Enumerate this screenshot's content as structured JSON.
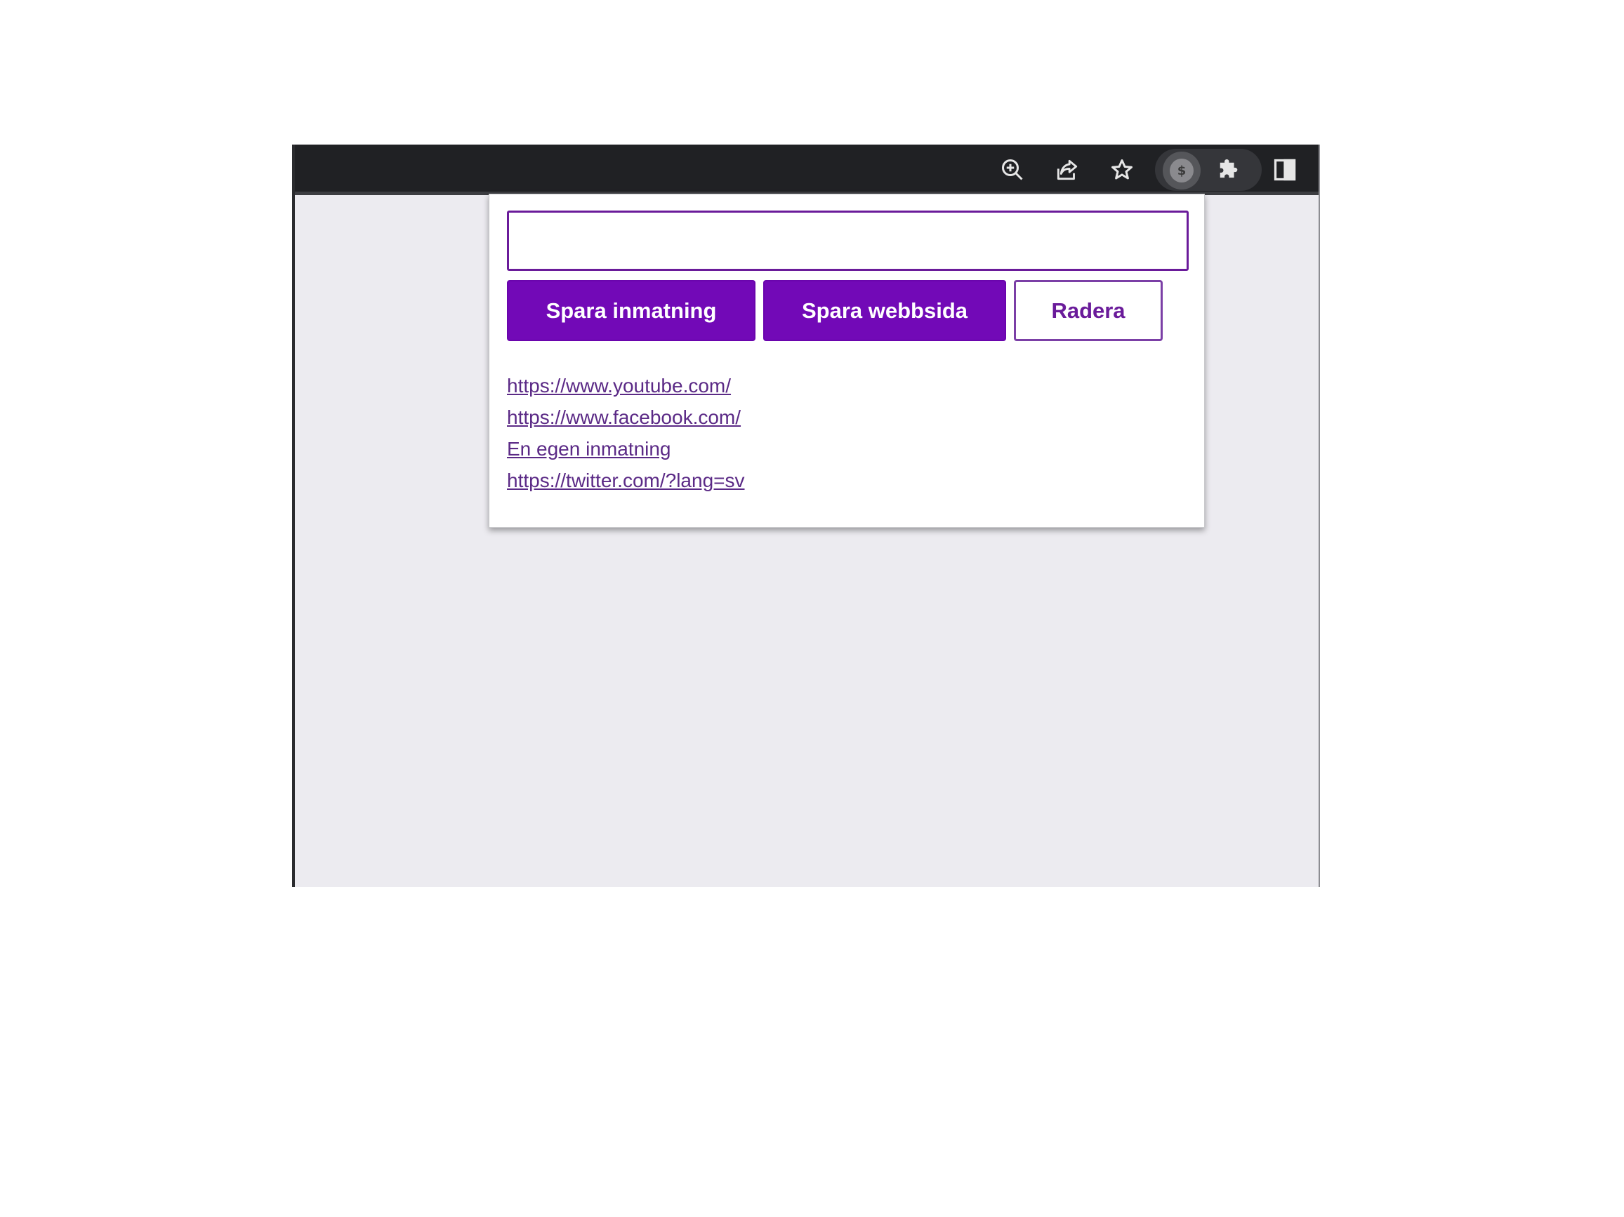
{
  "toolbar": {
    "icons": [
      "zoom-in-icon",
      "share-icon",
      "bookmark-star-icon",
      "extension-active-icon",
      "extensions-puzzle-icon",
      "side-panel-icon"
    ],
    "active_extension_glyph": "$"
  },
  "popup": {
    "input": {
      "value": "",
      "placeholder": ""
    },
    "buttons": {
      "save_input": "Spara inmatning",
      "save_tab": "Spara webbsida",
      "delete": "Radera"
    },
    "links": [
      "https://www.youtube.com/",
      "https://www.facebook.com/",
      "En egen inmatning",
      "https://twitter.com/?lang=sv"
    ]
  },
  "colors": {
    "primary": "#7209b7",
    "link": "#5b2a86",
    "toolbar_bg": "#202124",
    "page_bg": "#ecebf0"
  }
}
